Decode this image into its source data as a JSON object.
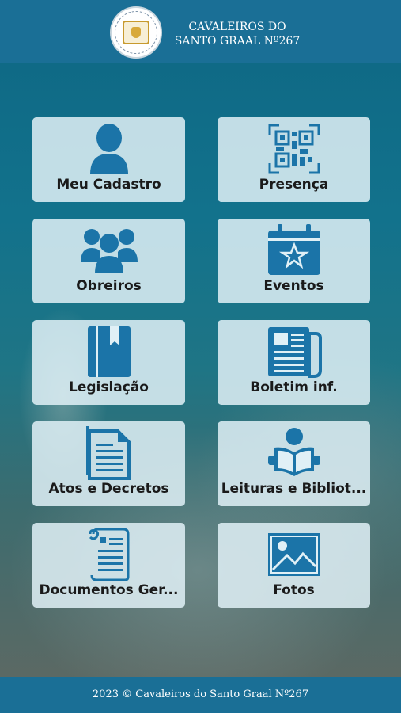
{
  "header": {
    "title_line1": "CAVALEIROS DO",
    "title_line2": "SANTO GRAAL Nº267"
  },
  "colors": {
    "header_bg": "#1a6f96",
    "icon_blue": "#1b74a8",
    "tile_bg": "#e0f0f6"
  },
  "tiles": [
    {
      "label": "Meu Cadastro",
      "icon": "user-icon"
    },
    {
      "label": "Presença",
      "icon": "qr-code-icon"
    },
    {
      "label": "Obreiros",
      "icon": "users-group-icon"
    },
    {
      "label": "Eventos",
      "icon": "calendar-star-icon"
    },
    {
      "label": "Legislação",
      "icon": "book-icon"
    },
    {
      "label": "Boletim inf.",
      "icon": "newspaper-icon"
    },
    {
      "label": "Atos e Decretos",
      "icon": "document-icon"
    },
    {
      "label": "Leituras e Bibliot...",
      "icon": "reading-person-icon"
    },
    {
      "label": "Documentos Ger...",
      "icon": "scroll-document-icon"
    },
    {
      "label": "Fotos",
      "icon": "image-icon"
    }
  ],
  "footer": {
    "text": "2023 © Cavaleiros do Santo Graal Nº267"
  }
}
